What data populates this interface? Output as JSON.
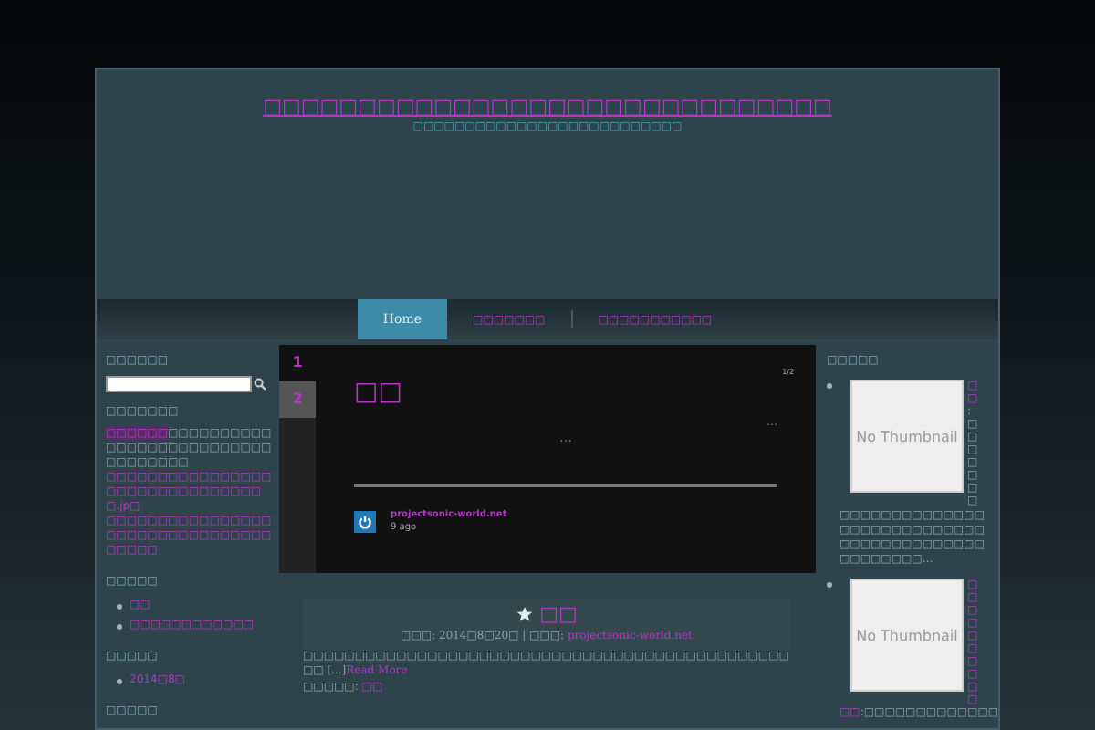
{
  "header": {
    "title": "□□□□□□□□□□□□□□□□□□□□□□□□□□□□□□",
    "tagline": "□□□□□□□□□□□□□□□□□□□□□□□□□□"
  },
  "nav": [
    {
      "label": "Home",
      "selected": true
    },
    {
      "label": "□□□□□□□",
      "selected": false
    },
    {
      "label": "□□□□□□□□□□□",
      "selected": false
    }
  ],
  "left_sidebar": {
    "search_heading": "□□□□□□",
    "profile_heading": "□□□□□□□",
    "profile_link": "□□□□□□",
    "profile_text": "□□□□□□□□□□□□□□□□□□□□□□□□□□□□□□□□□□",
    "profile_links": [
      "□□□□□□□□□□□□□□□□□□□□□□□□□□□□□□□□.jp□",
      "□□□□□□□□□□□□□□□□□□□□□□□□□□□□□□□□□□□□□"
    ],
    "sections": [
      {
        "heading": "□□□□□",
        "items": [
          "□□",
          "□□□□□□□□□□□□"
        ]
      },
      {
        "heading": "□□□□□",
        "items": [
          "2014□8□"
        ]
      }
    ],
    "last_heading": "□□□□□"
  },
  "slider": {
    "tabs": [
      {
        "label": "1",
        "selected": false
      },
      {
        "label": "2",
        "selected": true
      }
    ],
    "counter": "1/2",
    "title": "□□",
    "ellipsis": "…",
    "ellipsis_2": "…",
    "author": "projectsonic-world.net",
    "time": "9 ago"
  },
  "post": {
    "title": "□□",
    "date_label": "□□□: 2014□8□20□ | □□□: ",
    "author": "projectsonic-world.net",
    "excerpt": "□□□□□□□□□□□□□□□□□□□□□□□□□□□□□□□□□□□□□□□□□□□□□□□□□ [...]",
    "read_more": "Read More",
    "category_label": "□□□□□: ",
    "category": "□□"
  },
  "right_sidebar": {
    "heading": "□□□□□",
    "items": [
      {
        "thumbnail": "No Thumbnail",
        "title": "□□",
        "rest": ": □□□□□□□",
        "excerpt": "□□□□□□□□□□□□□□□□□□□□□□□□□□□□□□□□□□□□□□□□□□□□□□□□□□…"
      },
      {
        "thumbnail": "No Thumbnail",
        "title": "□□□□□□□□□□"
      }
    ],
    "last_link": "□□",
    "last_text": ":□□□□□□□□□□□□□"
  }
}
